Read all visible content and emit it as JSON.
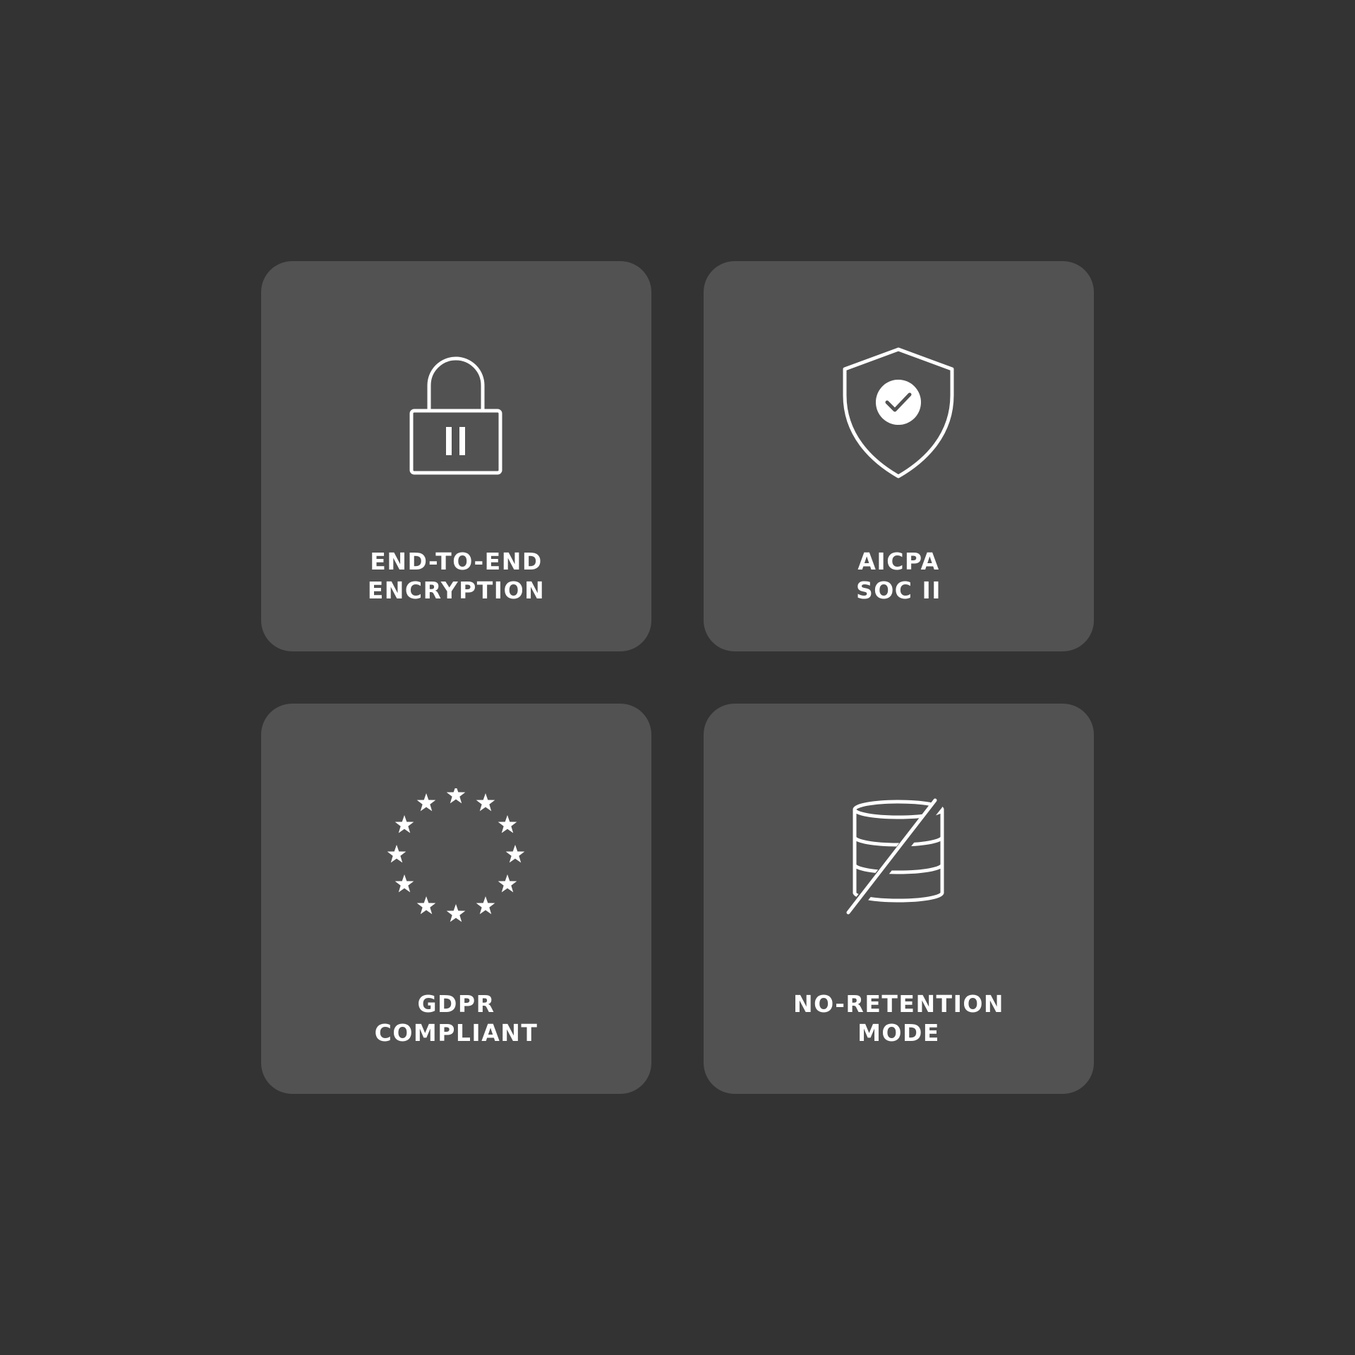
{
  "colors": {
    "background": "#333333",
    "card": "#525252",
    "foreground": "#ffffff"
  },
  "badges": [
    {
      "icon": "padlock-icon",
      "line1": "END-TO-END",
      "line2": "ENCRYPTION"
    },
    {
      "icon": "shield-check-icon",
      "line1": "AICPA",
      "line2": "SOC II"
    },
    {
      "icon": "eu-stars-icon",
      "line1": "GDPR",
      "line2": "COMPLIANT"
    },
    {
      "icon": "database-slash-icon",
      "line1": "NO-RETENTION",
      "line2": "MODE"
    }
  ]
}
